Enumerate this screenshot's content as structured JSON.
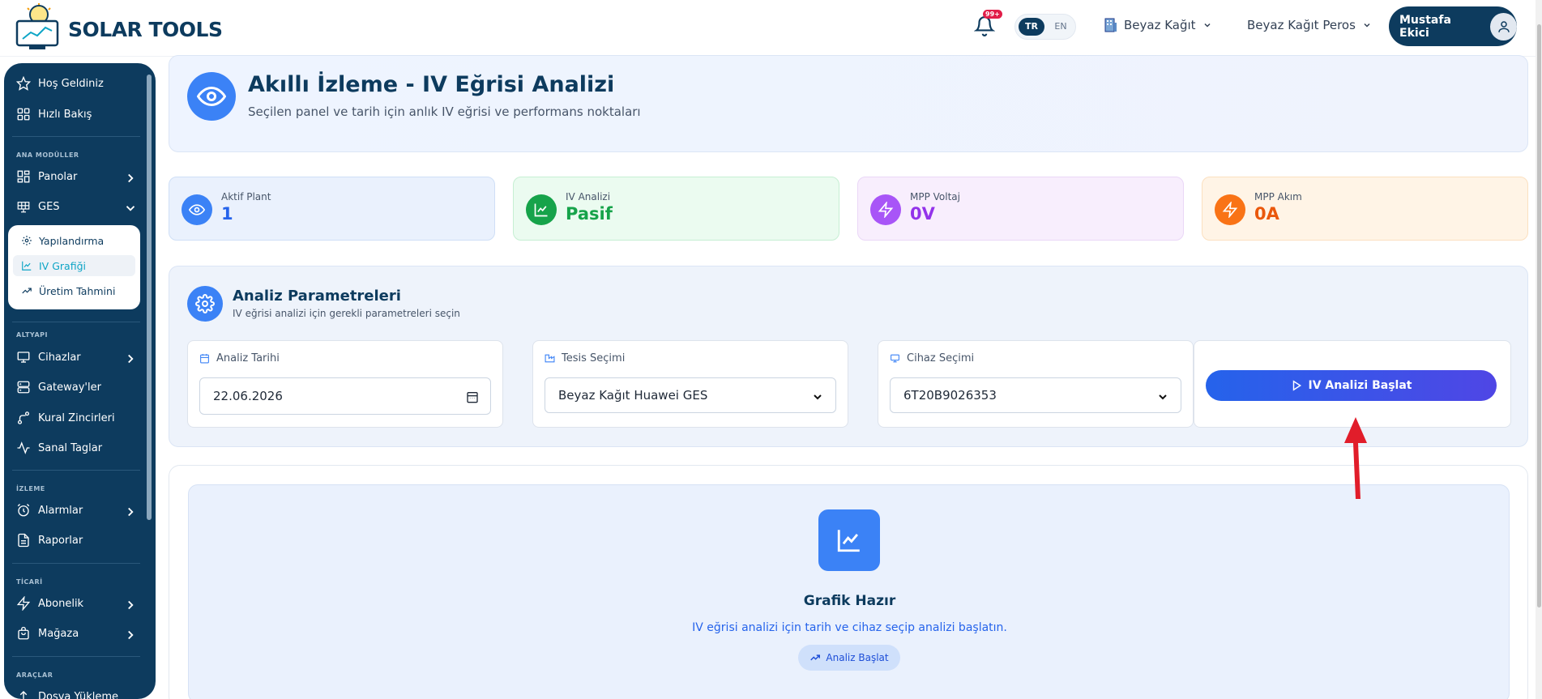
{
  "header": {
    "brand": "SOLAR TOOLS",
    "notification_count": "99+",
    "lang_tr": "TR",
    "lang_en": "EN",
    "company": "Beyaz Kağıt",
    "company2": "Beyaz Kağıt Peros",
    "user": "Mustafa Ekici"
  },
  "sidebar": {
    "welcome": "Hoş Geldiniz",
    "quick": "Hızlı Bakış",
    "section_main": "ANA MODÜLLER",
    "panels": "Panolar",
    "ges": "GES",
    "sub_config": "Yapılandırma",
    "sub_iv": "IV Grafiği",
    "sub_forecast": "Üretim Tahmini",
    "section_infra": "ALTYAPI",
    "devices": "Cihazlar",
    "gateways": "Gateway'ler",
    "rules": "Kural Zincirleri",
    "tags": "Sanal Taglar",
    "section_monitor": "İZLEME",
    "alarms": "Alarmlar",
    "reports": "Raporlar",
    "section_commerce": "TİCARİ",
    "subscription": "Abonelik",
    "store": "Mağaza",
    "section_tools": "ARAÇLAR",
    "upload": "Dosya Yükleme"
  },
  "title": {
    "main": "Akıllı İzleme - IV Eğrisi Analizi",
    "sub": "Seçilen panel ve tarih için anlık IV eğrisi ve performans noktaları"
  },
  "stats": [
    {
      "label": "Aktif Plant",
      "value": "1",
      "color": "#2563eb"
    },
    {
      "label": "IV Analizi",
      "value": "Pasif",
      "color": "#16a34a"
    },
    {
      "label": "MPP Voltaj",
      "value": "0V",
      "color": "#9333ea"
    },
    {
      "label": "MPP Akım",
      "value": "0A",
      "color": "#ea580c"
    }
  ],
  "params": {
    "title": "Analiz Parametreleri",
    "sub": "IV eğrisi analizi için gerekli parametreleri seçin",
    "date_label": "Analiz Tarihi",
    "date_value": "22.06.2026",
    "plant_label": "Tesis Seçimi",
    "plant_value": "Beyaz Kağıt Huawei GES",
    "device_label": "Cihaz Seçimi",
    "device_value": "6T20B9026353",
    "start_btn": "IV Analizi Başlat"
  },
  "chart": {
    "title": "Grafik Hazır",
    "sub": "IV eğrisi analizi için tarih ve cihaz seçip analizi başlatın.",
    "btn": "Analiz Başlat"
  }
}
